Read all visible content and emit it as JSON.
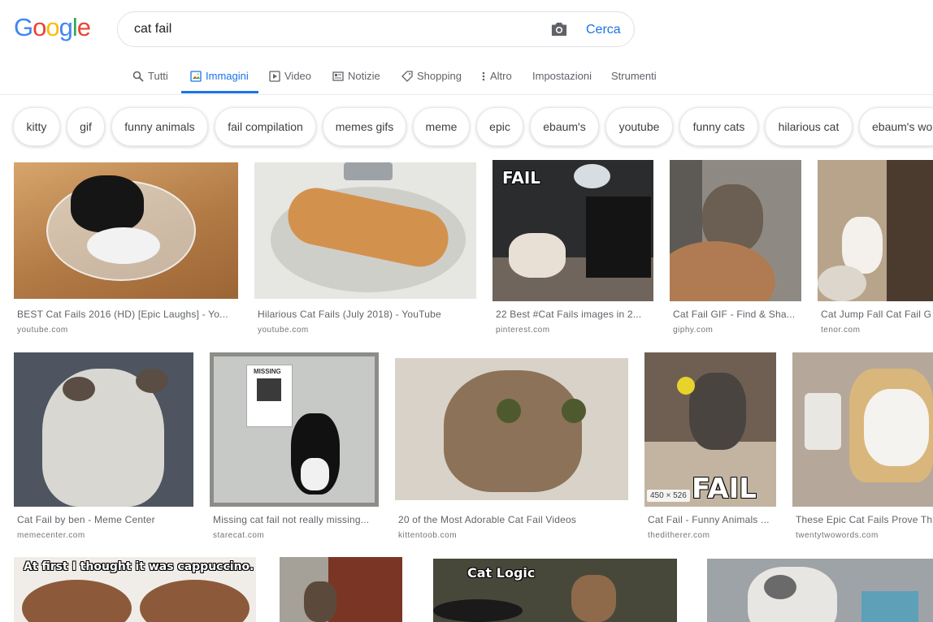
{
  "search": {
    "query": "cat fail",
    "button_label": "Cerca"
  },
  "tabs": [
    {
      "label": "Tutti",
      "icon": "search-icon"
    },
    {
      "label": "Immagini",
      "icon": "image-icon",
      "active": true
    },
    {
      "label": "Video",
      "icon": "video-icon"
    },
    {
      "label": "Notizie",
      "icon": "news-icon"
    },
    {
      "label": "Shopping",
      "icon": "tag-icon"
    },
    {
      "label": "Altro",
      "icon": "more-vert-icon"
    },
    {
      "label": "Impostazioni"
    },
    {
      "label": "Strumenti"
    }
  ],
  "chips": [
    "kitty",
    "gif",
    "funny animals",
    "fail compilation",
    "memes gifs",
    "meme",
    "epic",
    "ebaum's",
    "youtube",
    "funny cats",
    "hilarious cat",
    "ebaum's wo"
  ],
  "results": [
    {
      "title": "BEST Cat Fails 2016 (HD) [Epic Laughs] - Yo...",
      "domain": "youtube.com"
    },
    {
      "title": "Hilarious Cat Fails (July 2018) - YouTube",
      "domain": "youtube.com"
    },
    {
      "title": "22 Best #Cat Fails images in 2...",
      "domain": "pinterest.com",
      "overlay": "FAIL"
    },
    {
      "title": "Cat Fail GIF - Find & Sha...",
      "domain": "giphy.com"
    },
    {
      "title": "Cat Jump Fall Cat Fail G",
      "domain": "tenor.com"
    },
    {
      "title": "Cat Fail by ben - Meme Center",
      "domain": "memecenter.com"
    },
    {
      "title": "Missing cat fail not really missing...",
      "domain": "starecat.com",
      "overlay": "MISSING"
    },
    {
      "title": "20 of the Most Adorable Cat Fail Videos",
      "domain": "kittentoob.com"
    },
    {
      "title": "Cat Fail - Funny Animals ...",
      "domain": "theditherer.com",
      "overlay": "FAIL",
      "dims": "450 × 526"
    },
    {
      "title": "These Epic Cat Fails Prove Th",
      "domain": "twentytwowords.com"
    },
    {
      "title": "",
      "domain": "",
      "overlay": "At first I thought it was cappuccino."
    },
    {
      "title": "",
      "domain": ""
    },
    {
      "title": "",
      "domain": "",
      "overlay": "Cat Logic"
    },
    {
      "title": "",
      "domain": ""
    }
  ],
  "colors": {
    "accent": "#1a73e8",
    "logo_blue": "#4285f4",
    "logo_red": "#ea4335",
    "logo_yellow": "#fbbc05",
    "logo_green": "#34a853"
  }
}
